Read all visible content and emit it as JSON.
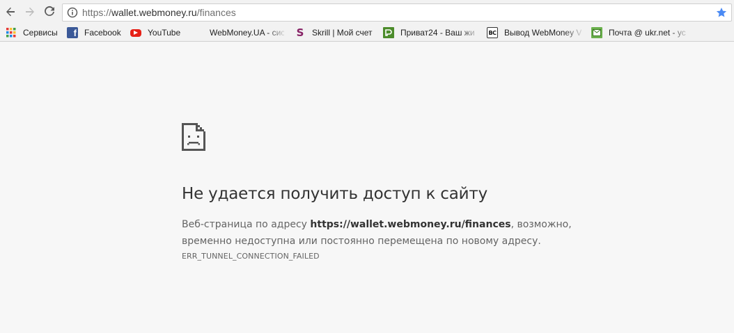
{
  "toolbar": {
    "url_scheme": "https://",
    "url_host": "wallet.webmoney.ru",
    "url_path": "/finances"
  },
  "bookmarks": [
    {
      "label": "Сервисы",
      "icon": "apps-grid-icon"
    },
    {
      "label": "Facebook",
      "icon": "facebook-icon"
    },
    {
      "label": "YouTube",
      "icon": "youtube-icon"
    },
    {
      "label": "WebMoney.UA - сис",
      "icon": "blank-icon"
    },
    {
      "label": "Skrill | Мой счет",
      "icon": "skrill-icon"
    },
    {
      "label": "Приват24 - Ваш жи",
      "icon": "privat24-icon"
    },
    {
      "label": "Вывод WebMoney V",
      "icon": "bc-icon"
    },
    {
      "label": "Почта @ ukr.net - ус",
      "icon": "mail-icon"
    }
  ],
  "error": {
    "title": "Не удается получить доступ к сайту",
    "desc_prefix": "Веб-страница по адресу ",
    "desc_url": "https://wallet.webmoney.ru/finances",
    "desc_suffix": ", возможно, временно недоступна или постоянно перемещена по новому адресу.",
    "code": "ERR_TUNNEL_CONNECTION_FAILED"
  },
  "colors": {
    "star": "#4a8af4",
    "facebook": "#3b5998",
    "youtube": "#e62117",
    "skrill": "#862165",
    "privat": "#4c8c2b"
  }
}
